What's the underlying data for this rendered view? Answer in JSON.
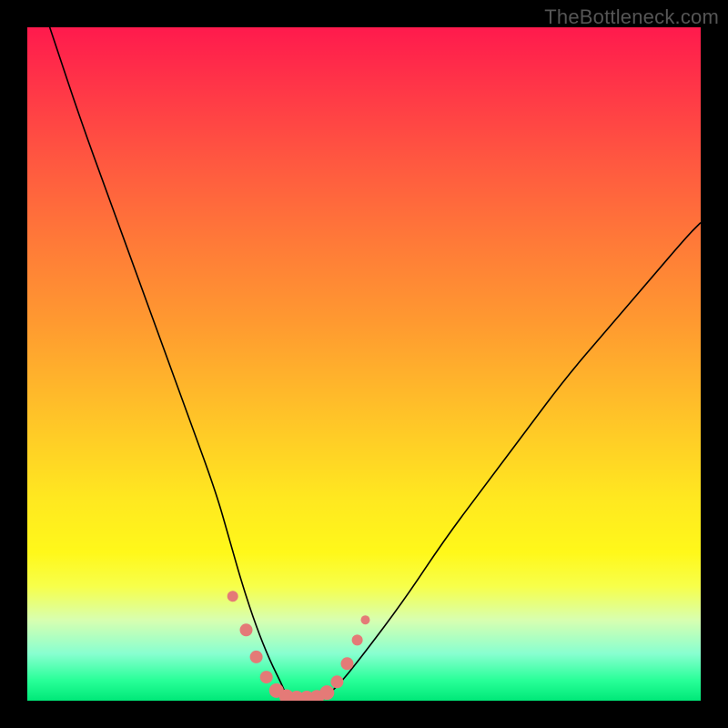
{
  "watermark": "TheBottleneck.com",
  "chart_data": {
    "type": "line",
    "title": "",
    "xlabel": "",
    "ylabel": "",
    "xlim": [
      0,
      100
    ],
    "ylim": [
      0,
      100
    ],
    "description": "Bottleneck V-curve over rainbow heat gradient. Y-axis roughly represents bottleneck percentage (top=high/red, bottom=low/green). The curve dips to ~0 near the balanced point.",
    "series": [
      {
        "name": "left-branch",
        "x": [
          0,
          4,
          8,
          12,
          16,
          20,
          24,
          28,
          30,
          32,
          34,
          36,
          38,
          38.5
        ],
        "y": [
          110,
          98,
          86,
          75,
          64,
          53,
          42,
          31,
          24,
          17,
          11,
          6,
          2,
          0.5
        ]
      },
      {
        "name": "right-branch",
        "x": [
          44,
          46,
          50,
          56,
          62,
          68,
          74,
          80,
          86,
          92,
          98,
          100
        ],
        "y": [
          0.5,
          2,
          7,
          15,
          24,
          32,
          40,
          48,
          55,
          62,
          69,
          71
        ]
      }
    ],
    "valley_flat": {
      "x_start": 38.5,
      "x_end": 44,
      "y": 0.3
    },
    "markers": {
      "color": "#e47a77",
      "radius_range": [
        5,
        9
      ],
      "points": [
        {
          "x": 30.5,
          "y": 15.5,
          "r": 6
        },
        {
          "x": 32.5,
          "y": 10.5,
          "r": 7
        },
        {
          "x": 34.0,
          "y": 6.5,
          "r": 7
        },
        {
          "x": 35.5,
          "y": 3.5,
          "r": 7
        },
        {
          "x": 37.0,
          "y": 1.5,
          "r": 8
        },
        {
          "x": 38.5,
          "y": 0.6,
          "r": 8
        },
        {
          "x": 40.0,
          "y": 0.4,
          "r": 8
        },
        {
          "x": 41.5,
          "y": 0.4,
          "r": 8
        },
        {
          "x": 43.0,
          "y": 0.5,
          "r": 8
        },
        {
          "x": 44.5,
          "y": 1.2,
          "r": 8
        },
        {
          "x": 46.0,
          "y": 2.8,
          "r": 7
        },
        {
          "x": 47.5,
          "y": 5.5,
          "r": 7
        },
        {
          "x": 49.0,
          "y": 9.0,
          "r": 6
        },
        {
          "x": 50.2,
          "y": 12.0,
          "r": 5
        }
      ]
    },
    "gradient_stops": [
      {
        "pct": 0,
        "color": "#ff1a4d"
      },
      {
        "pct": 20,
        "color": "#ff5840"
      },
      {
        "pct": 44,
        "color": "#ff9a30"
      },
      {
        "pct": 70,
        "color": "#ffe820"
      },
      {
        "pct": 88,
        "color": "#d8ffb0"
      },
      {
        "pct": 100,
        "color": "#00e878"
      }
    ]
  }
}
